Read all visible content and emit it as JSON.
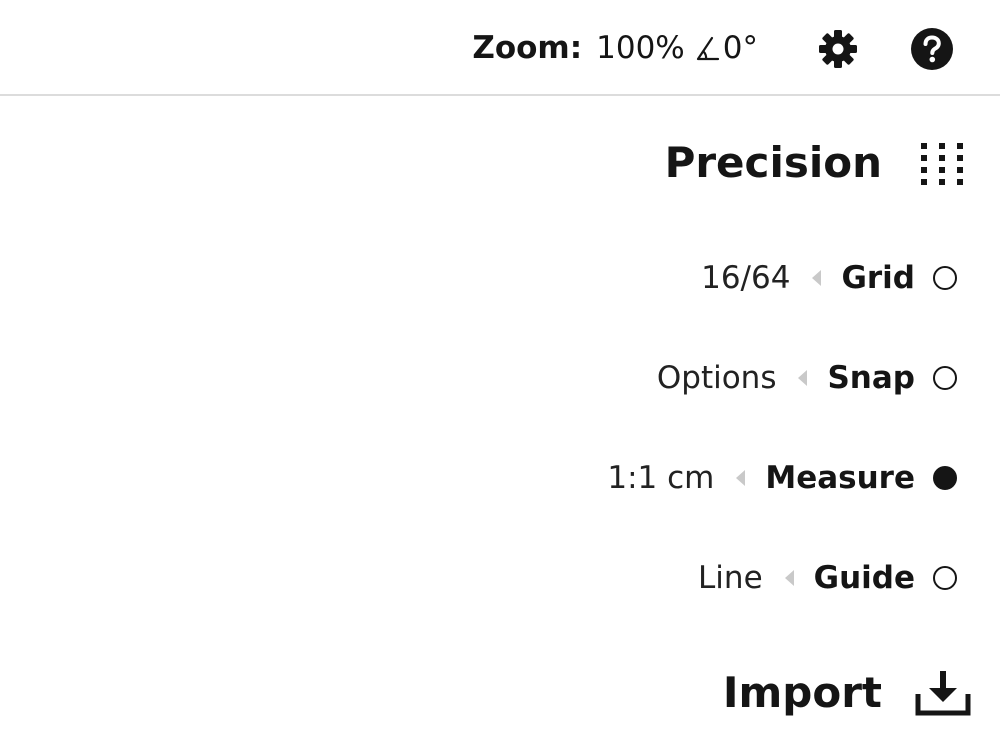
{
  "header": {
    "zoom_label": "Zoom:",
    "zoom_value": "100%",
    "angle_value": "0°",
    "icons": [
      "angle-icon",
      "gear-icon",
      "help-icon"
    ]
  },
  "precision": {
    "title": "Precision",
    "icon": "grid-dots-icon",
    "options": [
      {
        "value": "16/64",
        "label": "Grid",
        "selected": false
      },
      {
        "value": "Options",
        "label": "Snap",
        "selected": false
      },
      {
        "value": "1:1 cm",
        "label": "Measure",
        "selected": true
      },
      {
        "value": "Line",
        "label": "Guide",
        "selected": false
      }
    ]
  },
  "import": {
    "title": "Import",
    "icon": "download-icon"
  },
  "colors": {
    "text": "#151515",
    "divider": "#dcdcdc",
    "caret": "#c9c9c9",
    "background": "#ffffff"
  }
}
